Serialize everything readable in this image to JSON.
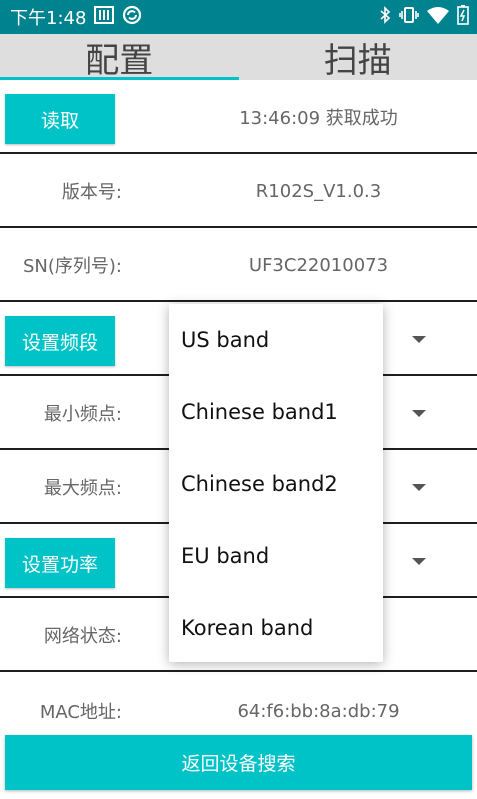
{
  "status_bar": {
    "time": "下午1:48",
    "icons": [
      "barcode-icon",
      "sync-icon",
      "bluetooth-icon",
      "vibrate-icon",
      "wifi-icon",
      "battery-icon"
    ]
  },
  "tabs": [
    {
      "label": "配置",
      "active": true
    },
    {
      "label": "扫描",
      "active": false
    }
  ],
  "colors": {
    "status_bar": "#00838f",
    "accent": "#00c3c8",
    "tab_bar": "#dedede"
  },
  "read": {
    "button_label": "读取",
    "status": "13:46:09 获取成功"
  },
  "version": {
    "label": "版本号:",
    "value": "R102S_V1.0.3"
  },
  "sn": {
    "label": "SN(序列号):",
    "value": "UF3C22010073"
  },
  "band": {
    "button_label": "设置频段"
  },
  "min_freq": {
    "label": "最小频点:"
  },
  "max_freq": {
    "label": "最大频点:"
  },
  "power": {
    "button_label": "设置功率"
  },
  "network": {
    "label": "网络状态:"
  },
  "mac": {
    "label": "MAC地址:",
    "value": "64:f6:bb:8a:db:79"
  },
  "dropdown": {
    "options": [
      "US band",
      "Chinese band1",
      "Chinese band2",
      "EU band",
      "Korean band"
    ]
  },
  "footer": {
    "button_label": "返回设备搜索"
  }
}
